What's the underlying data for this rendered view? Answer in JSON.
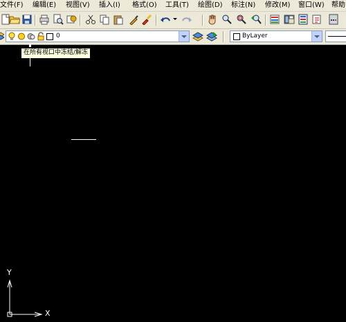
{
  "menu": {
    "items": [
      "文件(F)",
      "编辑(E)",
      "视图(V)",
      "插入(I)",
      "格式(O)",
      "工具(T)",
      "绘图(D)",
      "标注(N)",
      "修改(M)",
      "窗口(W)",
      "帮助"
    ]
  },
  "toolbar": {
    "icons": [
      "new-icon",
      "open-icon",
      "save-icon",
      "plot-icon",
      "preview-icon",
      "publish-icon",
      "cut-icon",
      "copy-icon",
      "paste-icon",
      "matchprop-icon",
      "brush-icon",
      "undo-icon",
      "redo-icon",
      "pan-icon",
      "zoom-realtime-icon",
      "zoom-window-icon",
      "zoom-previous-icon",
      "properties-icon",
      "designcenter-icon",
      "toolpalettes-icon",
      "markup-icon",
      "calc-icon"
    ]
  },
  "layer_toolbar": {
    "layer_name": "0",
    "color_combo_value": "ByLayer"
  },
  "tooltip": {
    "text": "在所有视口中冻结/解冻"
  },
  "ucs": {
    "x_label": "X",
    "y_label": "Y"
  },
  "colors": {
    "toolbar_bg": "#ece9d8",
    "canvas_bg": "#000000",
    "tooltip_bg": "#ffffe1",
    "drawing_line": "#ffffff"
  }
}
